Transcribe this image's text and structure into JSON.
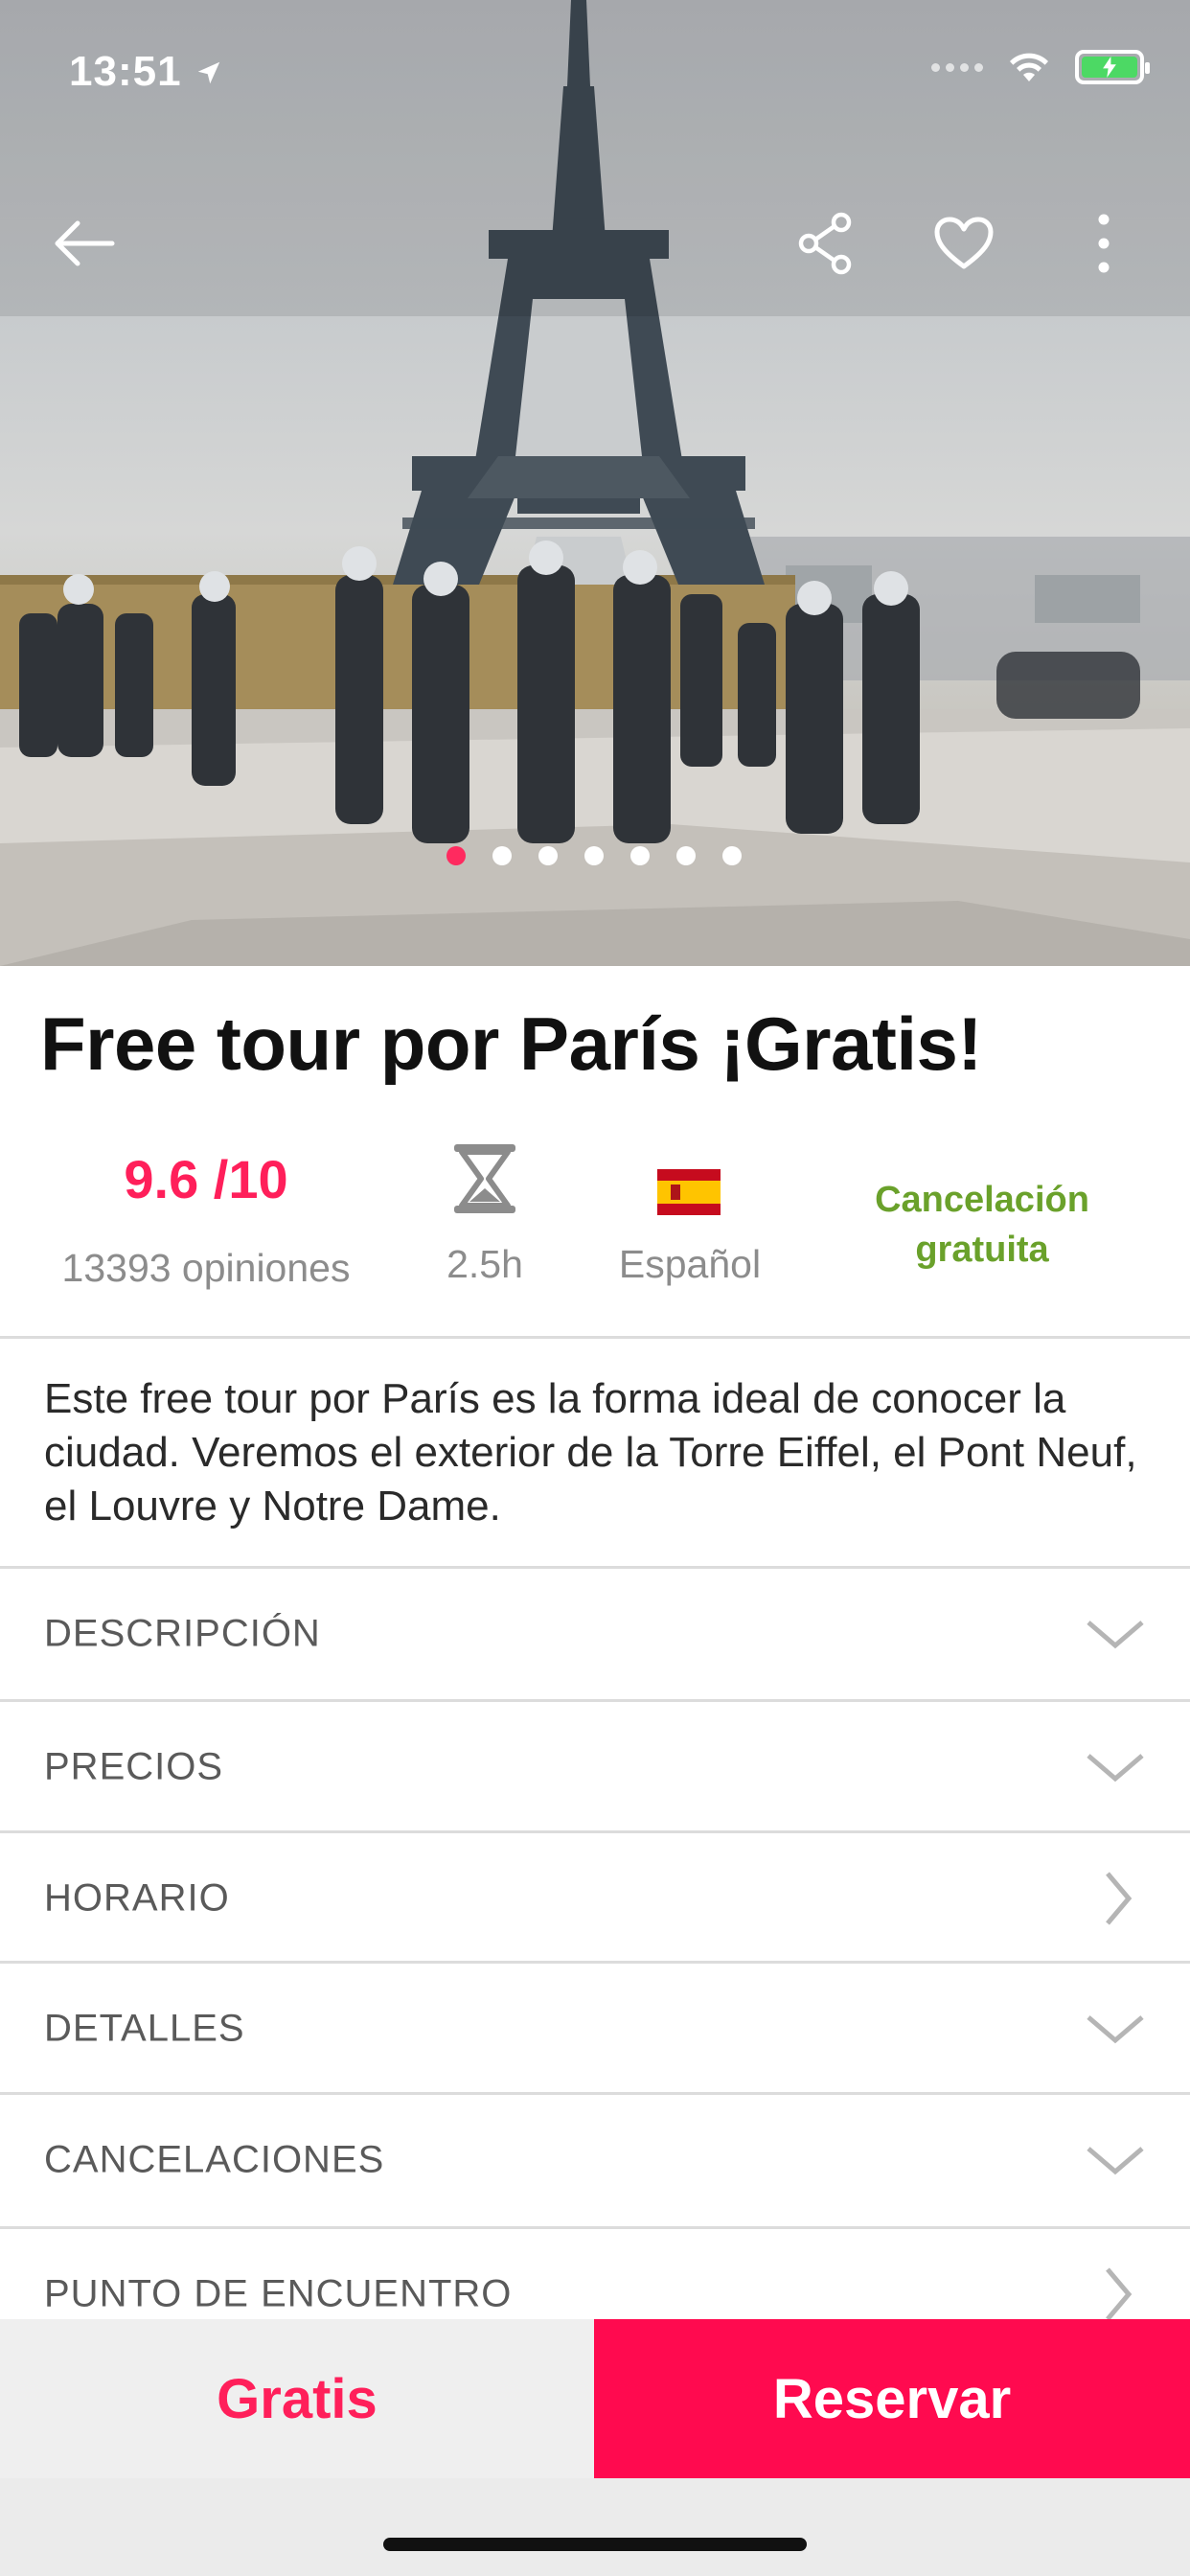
{
  "status_bar": {
    "time": "13:51"
  },
  "hero": {
    "image_subject": "Eiffel Tower with tourists at Trocadéro",
    "active_slide": 1,
    "slide_count": 7
  },
  "tour": {
    "title": "Free tour por París ¡Gratis!",
    "rating": "9.6 /10",
    "reviews": "13393 opiniones",
    "duration": "2.5h",
    "language": "Español",
    "cancellation": "Cancelación gratuita",
    "description": "Este free tour por París es la forma ideal de conocer la ciudad. Veremos el exterior de la Torre Eiffel, el Pont Neuf, el Louvre y Notre Dame."
  },
  "sections": [
    {
      "label": "DESCRIPCIÓN",
      "icon": "chevron-down-icon"
    },
    {
      "label": "PRECIOS",
      "icon": "chevron-down-icon"
    },
    {
      "label": "HORARIO",
      "icon": "chevron-right-icon"
    },
    {
      "label": "DETALLES",
      "icon": "chevron-down-icon"
    },
    {
      "label": "CANCELACIONES",
      "icon": "chevron-down-icon"
    },
    {
      "label": "PUNTO DE ENCUENTRO",
      "icon": "chevron-right-icon"
    }
  ],
  "bottom_bar": {
    "price": "Gratis",
    "book_label": "Reservar"
  },
  "colors": {
    "accent": "#ff0a4f",
    "rating": "#ff1f5a",
    "cancellation": "#6aa12b"
  }
}
